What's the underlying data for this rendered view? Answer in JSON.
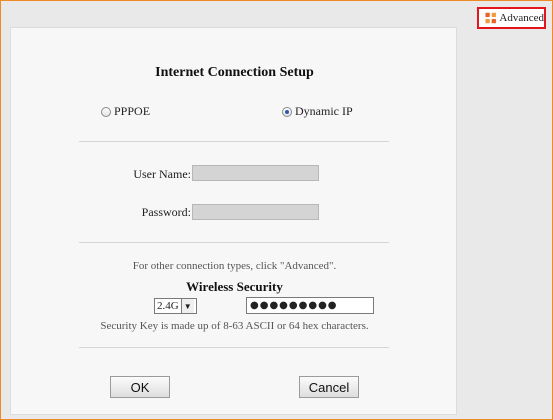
{
  "header": {
    "advanced_label": "Advanced",
    "advanced_icon": "gear-icon"
  },
  "setup": {
    "title": "Internet Connection Setup",
    "connection_types": [
      {
        "label": "PPPOE",
        "selected": false
      },
      {
        "label": "Dynamic IP",
        "selected": true
      }
    ],
    "username_label": "User Name:",
    "username_value": "",
    "password_label": "Password:",
    "password_value": ""
  },
  "wireless": {
    "note": "For other connection types, click \"Advanced\".",
    "title": "Wireless Security",
    "band_selected": "2.4G",
    "key_masked": "●●●●●●●●●",
    "key_hint": "Security Key is made up of 8-63 ASCII or 64 hex characters."
  },
  "actions": {
    "ok_label": "OK",
    "cancel_label": "Cancel"
  },
  "colors": {
    "highlight_border": "#e3161e",
    "frame_border": "#f08a24",
    "icon_accent": "#e8622a"
  }
}
